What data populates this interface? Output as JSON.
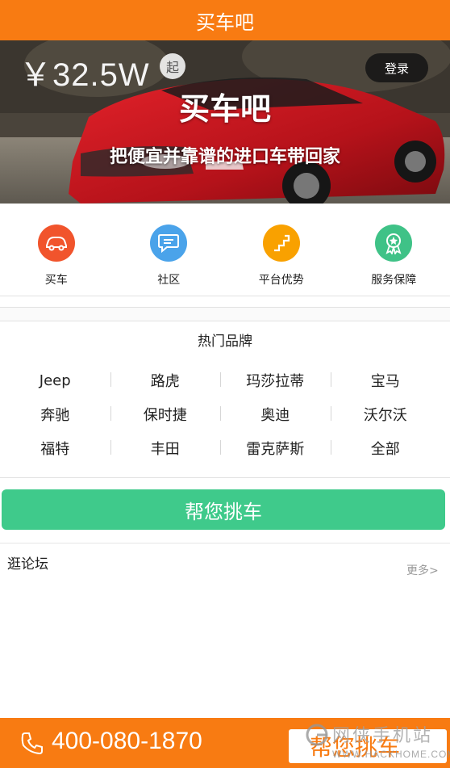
{
  "app": {
    "title": "买车吧"
  },
  "banner": {
    "price": "￥32.5W",
    "price_suffix": "起",
    "login_label": "登录",
    "title": "买车吧",
    "subtitle": "把便宜并靠谱的进口车带回家"
  },
  "quicknav": [
    {
      "label": "买车",
      "icon": "car-icon",
      "color": "#f1542c"
    },
    {
      "label": "社区",
      "icon": "chat-bubble-icon",
      "color": "#4aa3ea"
    },
    {
      "label": "平台优势",
      "icon": "stairs-icon",
      "color": "#f9a100"
    },
    {
      "label": "服务保障",
      "icon": "medal-icon",
      "color": "#3fc287"
    }
  ],
  "brands": {
    "title": "热门品牌",
    "rows": [
      [
        "Jeep",
        "路虎",
        "玛莎拉蒂",
        "宝马"
      ],
      [
        "奔驰",
        "保时捷",
        "奥迪",
        "沃尔沃"
      ],
      [
        "福特",
        "丰田",
        "雷克萨斯",
        "全部"
      ]
    ]
  },
  "pick_button": "帮您挑车",
  "forum": {
    "title": "逛论坛",
    "more": "更多>"
  },
  "bottom": {
    "phone": "400-080-1870",
    "button": "帮您挑车",
    "watermark_top": "网侠手机站",
    "watermark_bottom": "WWW.HACKHOME.COM"
  },
  "colors": {
    "accent": "#f87b12",
    "green": "#3fca8b"
  }
}
